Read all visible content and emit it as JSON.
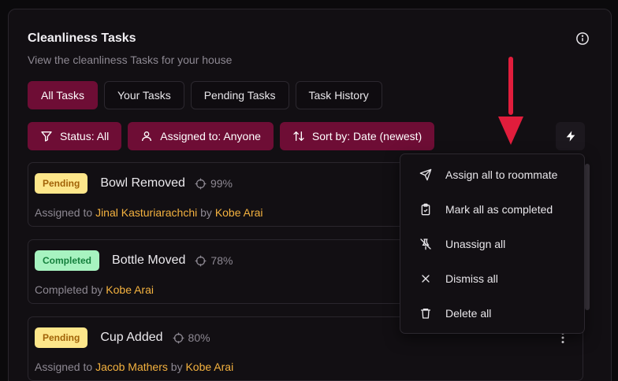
{
  "header": {
    "title": "Cleanliness Tasks",
    "subtitle": "View the cleanliness Tasks for your house"
  },
  "tabs": [
    {
      "label": "All Tasks",
      "active": true
    },
    {
      "label": "Your Tasks",
      "active": false
    },
    {
      "label": "Pending Tasks",
      "active": false
    },
    {
      "label": "Task History",
      "active": false
    }
  ],
  "filters": {
    "status": "Status: All",
    "assigned": "Assigned to: Anyone",
    "sort": "Sort by: Date (newest)"
  },
  "tasks": [
    {
      "status": "Pending",
      "name": "Bowl Removed",
      "confidence": "99%",
      "prefix": "Assigned to",
      "assignee": "Jinal Kasturiarachchi",
      "by_word": "by",
      "by": "Kobe Arai"
    },
    {
      "status": "Completed",
      "name": "Bottle Moved",
      "confidence": "78%",
      "prefix": "Completed by",
      "by": "Kobe Arai"
    },
    {
      "status": "Pending",
      "name": "Cup Added",
      "confidence": "80%",
      "prefix": "Assigned to",
      "assignee": "Jacob Mathers",
      "by_word": "by",
      "by": "Kobe Arai"
    }
  ],
  "bulk_menu": {
    "items": [
      {
        "label": "Assign all to roommate",
        "icon": "send-icon"
      },
      {
        "label": "Mark all as completed",
        "icon": "clipboard-check-icon"
      },
      {
        "label": "Unassign all",
        "icon": "pin-off-icon"
      },
      {
        "label": "Dismiss all",
        "icon": "x-icon"
      },
      {
        "label": "Delete all",
        "icon": "trash-icon"
      }
    ]
  },
  "colors": {
    "accent": "#6e0d35",
    "person": "#f4b23f",
    "pending_bg": "#fde68a",
    "completed_bg": "#a7f3c0",
    "annotation_arrow": "#e11d3c"
  }
}
